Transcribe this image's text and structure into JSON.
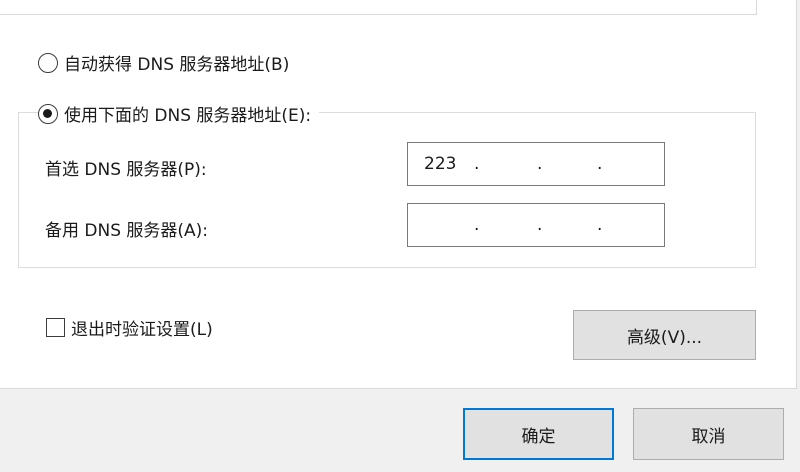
{
  "dialog": {
    "auto_dns_label": "自动获得 DNS 服务器地址(B)",
    "manual_dns_label": "使用下面的 DNS 服务器地址(E):",
    "preferred_dns_label": "首选 DNS 服务器(P):",
    "alternate_dns_label": "备用 DNS 服务器(A):",
    "preferred_dns_octets": [
      "223",
      "",
      "",
      ""
    ],
    "alternate_dns_octets": [
      "",
      "",
      "",
      ""
    ],
    "octet_separator": ".",
    "validate_on_exit_label": "退出时验证设置(L)",
    "advanced_label": "高级(V)...",
    "ok_label": "确定",
    "cancel_label": "取消",
    "auto_dns_selected": false,
    "manual_dns_selected": true,
    "validate_on_exit_checked": false
  },
  "colors": {
    "dialog_bg": "#f0f0f0",
    "panel_bg": "#ffffff",
    "button_bg": "#e1e1e1",
    "focus_border": "#0078d7"
  }
}
